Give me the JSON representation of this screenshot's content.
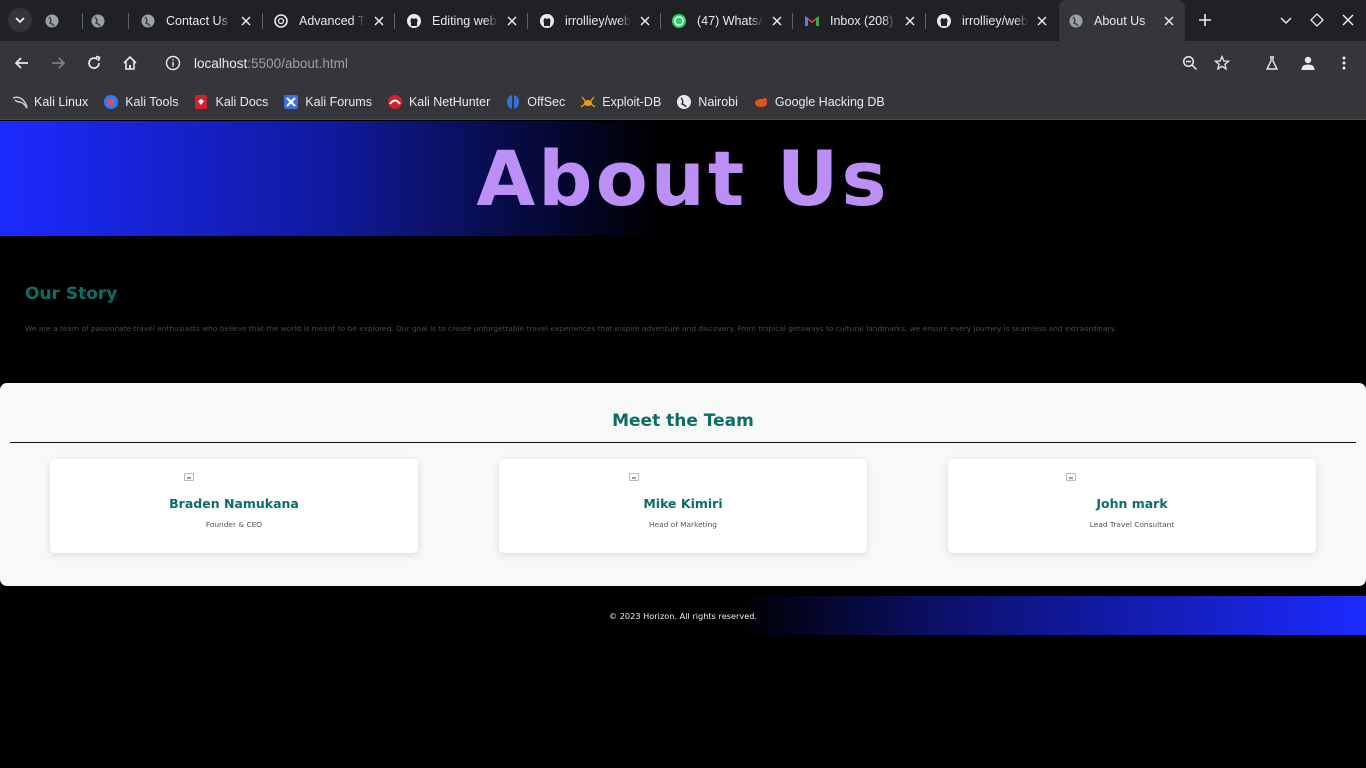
{
  "browser": {
    "tabs": [
      {
        "title": "",
        "icon": "globe-icon",
        "active": false
      },
      {
        "title": "",
        "icon": "globe-icon",
        "active": false
      },
      {
        "title": "Contact Us",
        "icon": "globe-icon",
        "active": false
      },
      {
        "title": "Advanced T",
        "icon": "openai-icon",
        "active": false
      },
      {
        "title": "Editing web",
        "icon": "github-icon",
        "active": false
      },
      {
        "title": "irrolliey/web",
        "icon": "github-icon",
        "active": false
      },
      {
        "title": "(47) WhatsA",
        "icon": "whatsapp-icon",
        "active": false
      },
      {
        "title": "Inbox (208)",
        "icon": "gmail-icon",
        "active": false
      },
      {
        "title": "irrolliey/web",
        "icon": "github-icon",
        "active": false
      },
      {
        "title": "About Us",
        "icon": "globe-icon",
        "active": true
      }
    ],
    "url": {
      "host": "localhost",
      "path": ":5500/about.html"
    },
    "bookmarks": [
      {
        "label": "Kali Linux",
        "icon": "kali-dragon-icon"
      },
      {
        "label": "Kali Tools",
        "icon": "kali-tools-icon"
      },
      {
        "label": "Kali Docs",
        "icon": "kali-docs-icon"
      },
      {
        "label": "Kali Forums",
        "icon": "kali-forums-icon"
      },
      {
        "label": "Kali NetHunter",
        "icon": "nethunter-icon"
      },
      {
        "label": "OffSec",
        "icon": "offsec-icon"
      },
      {
        "label": "Exploit-DB",
        "icon": "exploit-db-icon"
      },
      {
        "label": "Nairobi",
        "icon": "globe-icon"
      },
      {
        "label": "Google Hacking DB",
        "icon": "ghdb-icon"
      }
    ]
  },
  "page": {
    "hero_title": "About Us",
    "story": {
      "heading": "Our Story",
      "text": "We are a team of passionate travel enthusiasts who believe that the world is meant to be explored. Our goal is to create unforgettable travel experiences that inspire adventure and discovery. From tropical getaways to cultural landmarks, we ensure every journey is seamless and extraordinary."
    },
    "team": {
      "heading": "Meet the Team",
      "members": [
        {
          "name": "Braden Namukana",
          "role": "Founder & CEO"
        },
        {
          "name": "Mike Kimiri",
          "role": "Head of Marketing"
        },
        {
          "name": "John mark",
          "role": "Lead Travel Consultant"
        }
      ]
    },
    "footer": "© 2023 Horizon. All rights reserved."
  },
  "colors": {
    "hero_title": "#bb8ff6",
    "heading_teal": "#0b6e62",
    "gradient_blue": "#1c2aff"
  }
}
